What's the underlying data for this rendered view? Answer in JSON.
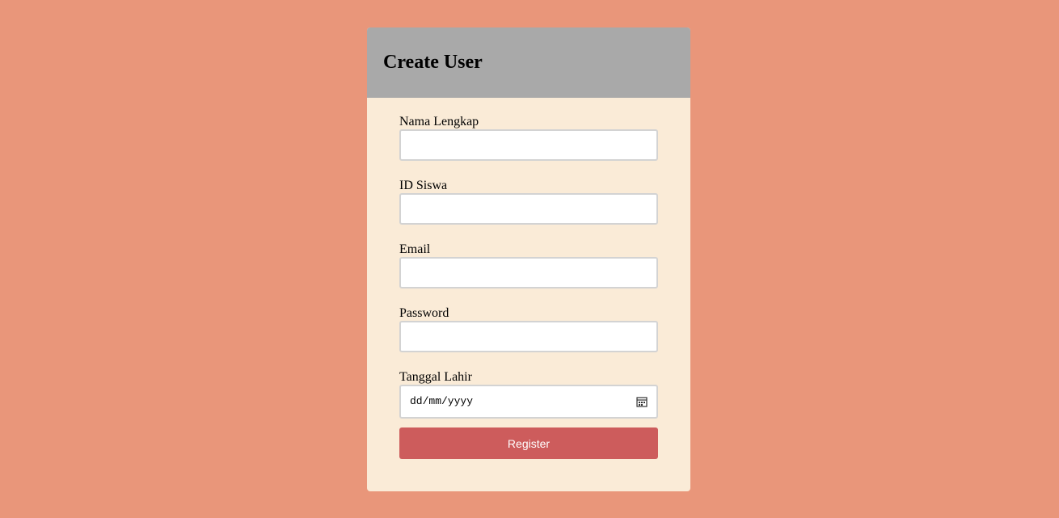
{
  "form": {
    "title": "Create User",
    "fields": [
      {
        "label": "Nama Lengkap",
        "value": "",
        "type": "text"
      },
      {
        "label": "ID Siswa",
        "value": "",
        "type": "text"
      },
      {
        "label": "Email",
        "value": "",
        "type": "email"
      },
      {
        "label": "Password",
        "value": "",
        "type": "password"
      },
      {
        "label": "Tanggal Lahir",
        "value": "dd/mm/yyyy",
        "type": "date"
      }
    ],
    "submit_label": "Register"
  },
  "icons": {
    "date_picker": "calendar-icon"
  },
  "colors": {
    "page_background": "#e9967a",
    "card_background": "#faebd7",
    "header_background": "#a9a9a9",
    "button_background": "#cd5c5c",
    "button_text": "#ffffff"
  }
}
